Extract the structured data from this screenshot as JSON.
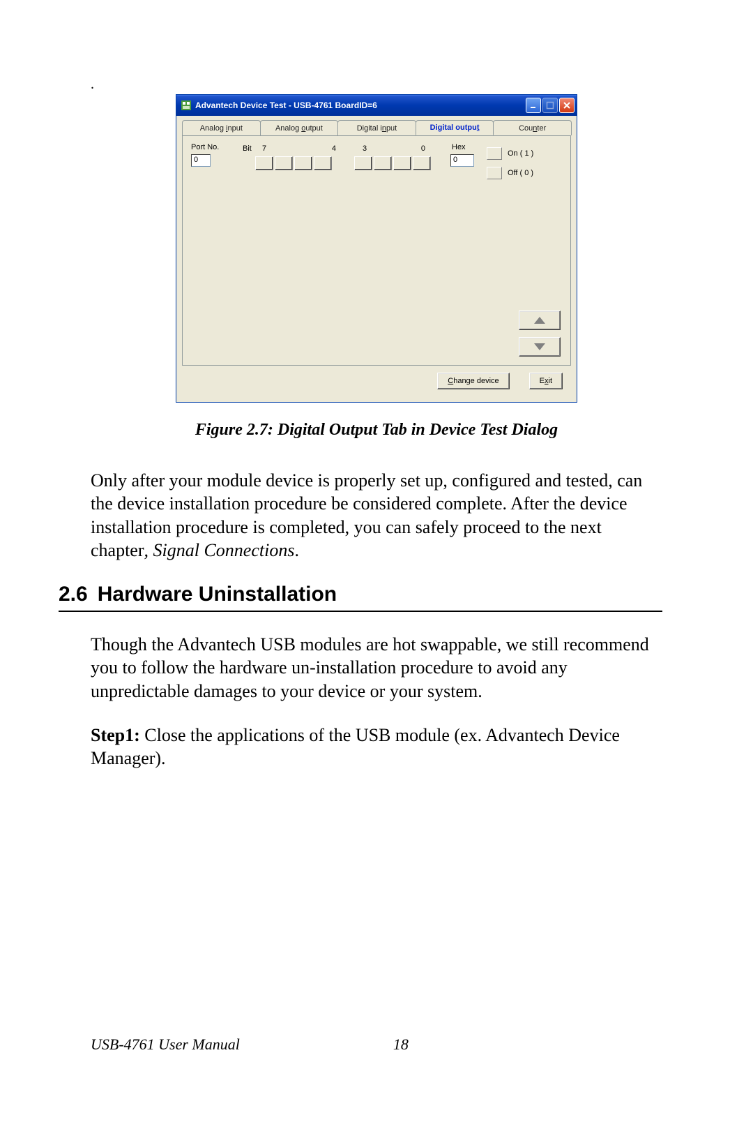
{
  "dialog": {
    "title": "Advantech Device Test - USB-4761 BoardID=6",
    "tabs": {
      "analog_input": "Analog input",
      "analog_output": "Analog output",
      "digital_input": "Digital input",
      "digital_output": "Digital output",
      "counter": "Counter"
    },
    "do_panel": {
      "port_no_label": "Port No.",
      "bit_label": "Bit",
      "bit_7": "7",
      "bit_4": "4",
      "bit_3": "3",
      "bit_0": "0",
      "port_no_value": "0",
      "hex_label": "Hex",
      "hex_value": "0",
      "legend_on": "On ( 1 )",
      "legend_off": "Off ( 0 )"
    },
    "buttons": {
      "change_device": "Change device",
      "exit": "Exit"
    }
  },
  "doc": {
    "figure_caption": "Figure 2.7: Digital Output Tab in Device Test Dialog",
    "para1_a": "Only after your module device is properly set up, configured and tested, can the device installation procedure be considered complete. After the device installation procedure is completed, you can safely proceed to the next chapter",
    "para1_b_ital": ", Signal Connections",
    "para1_c": ".",
    "section_num": "2.6",
    "section_title": "Hardware Uninstallation",
    "para2": "Though the Advantech USB modules are hot swappable, we still recommend you to follow the hardware un-installation procedure to avoid any unpredictable damages to your device or your system.",
    "step1_label": "Step1:",
    "step1_text": " Close the applications of the USB module (ex. Advantech Device Manager).",
    "footer_title": "USB-4761 User Manual",
    "footer_page": "18"
  }
}
